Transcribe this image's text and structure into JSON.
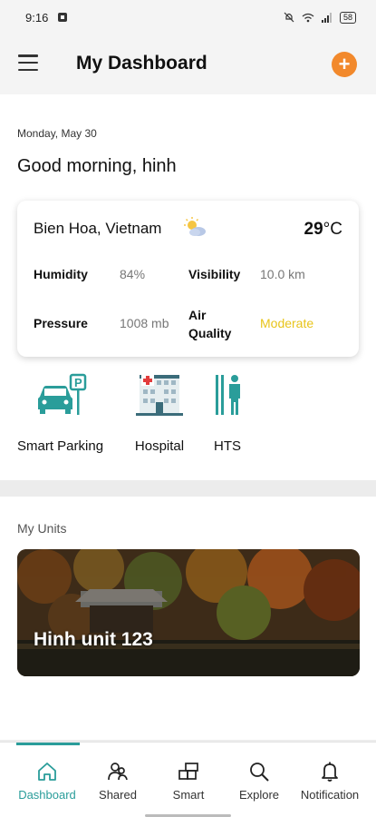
{
  "status_bar": {
    "time": "9:16",
    "battery": "58"
  },
  "header": {
    "title": "My Dashboard"
  },
  "greeting": {
    "date": "Monday, May 30",
    "text": "Good morning, hinh"
  },
  "weather": {
    "location": "Bien Hoa, Vietnam",
    "temperature": "29",
    "temperature_unit": "°C",
    "humidity_label": "Humidity",
    "humidity_value": "84%",
    "visibility_label": "Visibility",
    "visibility_value": "10.0 km",
    "pressure_label": "Pressure",
    "pressure_value": "1008 mb",
    "air_quality_label": "Air Quality",
    "air_quality_value": "Moderate",
    "icon": "partly-cloudy-icon"
  },
  "services": [
    {
      "label": "Smart Parking",
      "icon": "smart-parking-icon"
    },
    {
      "label": "Hospital",
      "icon": "hospital-icon"
    },
    {
      "label": "HTS",
      "icon": "hts-icon"
    }
  ],
  "units": {
    "title": "My Units",
    "items": [
      {
        "name": "Hinh unit 123"
      }
    ]
  },
  "nav": [
    {
      "label": "Dashboard",
      "icon": "home-icon",
      "active": true
    },
    {
      "label": "Shared",
      "icon": "shared-users-icon",
      "active": false
    },
    {
      "label": "Smart",
      "icon": "smart-devices-icon",
      "active": false
    },
    {
      "label": "Explore",
      "icon": "search-icon",
      "active": false
    },
    {
      "label": "Notification",
      "icon": "bell-icon",
      "active": false
    }
  ],
  "colors": {
    "accent": "#2a9d9a",
    "orange": "#f2892c",
    "moderate": "#e8c41a"
  }
}
